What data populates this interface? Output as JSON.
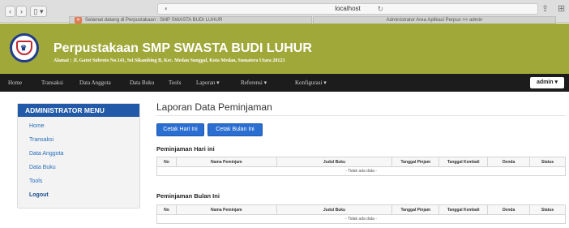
{
  "browser": {
    "url": "localhost",
    "tabs": [
      "Selamat datang di Perpustakaan : SMP SWASTA BUDI LUHUR",
      "Administrator Area Aplikasi Perpus >> admin"
    ]
  },
  "header": {
    "school_name": "Perpustakaan SMP SWASTA BUDI LUHUR",
    "address": "Alamat : Jl. Gatot Subroto No.141, Sei Sikambing B, Kec. Medan Sunggal, Kota Medan, Sumatera Utara 20123"
  },
  "navbar": {
    "items": [
      "Home",
      "Transaksi",
      "Data Anggota",
      "Data Buku",
      "Tools",
      "Laporan ▾",
      "Referensi ▾",
      "Konfigurasi ▾"
    ],
    "user_menu": "admin ▾"
  },
  "sidebar": {
    "title": "ADMINISTRATOR MENU",
    "items": [
      "Home",
      "Transaksi",
      "Data Anggota",
      "Data Buku",
      "Tools",
      "Logout"
    ]
  },
  "main": {
    "title": "Laporan Data Peminjaman",
    "buttons": [
      "Cetak Hari Ini",
      "Cetak Bulan Ini"
    ],
    "table_today_title": "Peminjaman Hari ini",
    "table_month_title": "Peminjaman Bulan Ini",
    "columns": [
      "No",
      "Nama Peminjam",
      "Judul Buku",
      "Tanggal Pinjam",
      "Tanggal Kembali",
      "Denda",
      "Status"
    ],
    "empty_message": "- Tidak ada data -"
  }
}
